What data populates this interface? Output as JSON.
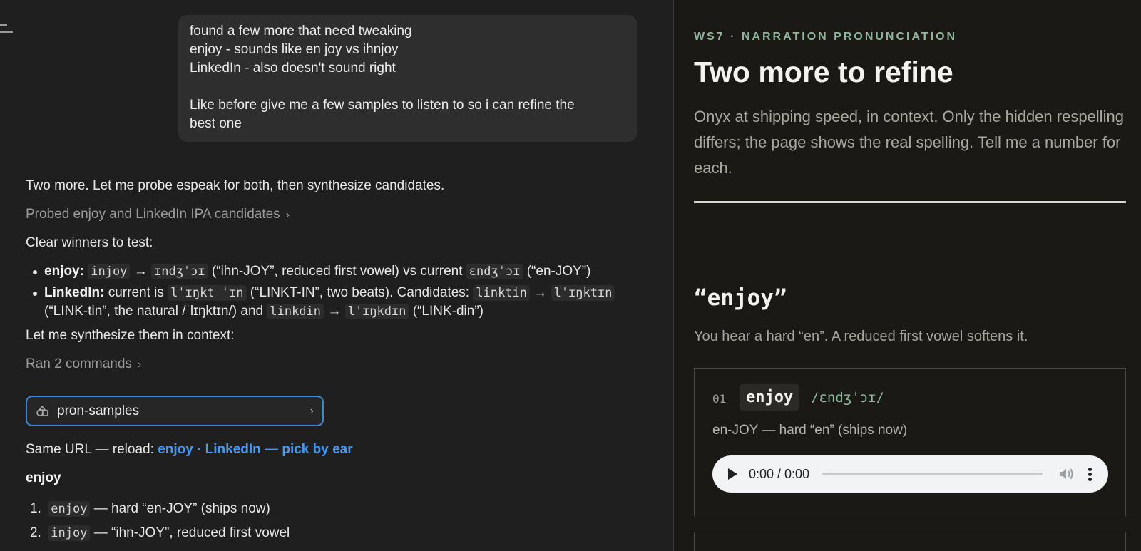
{
  "chat": {
    "user_message": {
      "lines": [
        "found a few more that need tweaking",
        "enjoy - sounds like en joy vs ihnjoy",
        "LinkedIn - also doesn't sound right",
        "",
        "Like before give me a few samples to listen to so i can refine the",
        "best one"
      ]
    },
    "assistant": {
      "intro": "Two more. Let me probe espeak for both, then synthesize candidates.",
      "probe_toggle": "Probed enjoy and LinkedIn IPA candidates",
      "winners_heading": "Clear winners to test:",
      "bullet_enjoy": {
        "label": "enjoy:",
        "code1": "injoy",
        "arrow": "→",
        "code2": "ɪndʒˈɔɪ",
        "text1": "(“ihn-JOY”, reduced first vowel) vs current",
        "code3": "ɛndʒˈɔɪ",
        "text2": "(“en-JOY”)"
      },
      "bullet_linkedin": {
        "label": "LinkedIn:",
        "text1": "current is",
        "code1": "lˈɪŋkt ˈɪn",
        "text2": "(“LINKT-IN”, two beats). Candidates:",
        "code2": "linktin",
        "arrow": "→",
        "code3": "lˈɪŋktɪn",
        "text3": "(“LINK-tin”, the natural /ˈlɪŋktɪn/) and",
        "code4": "linkdin",
        "code5": "lˈɪŋkdɪn",
        "text4": "(“LINK-din”)"
      },
      "synth_line": "Let me synthesize them in context:",
      "commands_toggle": "Ran 2 commands",
      "artifact_name": "pron-samples",
      "reload_prefix": "Same URL — reload:",
      "reload_link": "enjoy · LinkedIn — pick by ear",
      "section_heading": "enjoy",
      "picks": [
        {
          "num": "1.",
          "code": "enjoy",
          "text": "— hard “en-JOY” (ships now)"
        },
        {
          "num": "2.",
          "code": "injoy",
          "text": "— “ihn-JOY”, reduced first vowel"
        }
      ]
    }
  },
  "preview": {
    "eyebrow": "WS7 · NARRATION PRONUNCIATION",
    "title": "Two more to refine",
    "description": "Onyx at shipping speed, in context. Only the hidden respelling differs; the page shows the real spelling. Tell me a number for each.",
    "word_heading": "“enjoy”",
    "word_description": "You hear a hard “en”. A reduced first vowel softens it.",
    "cards": [
      {
        "index": "01",
        "word": "enjoy",
        "ipa": "/ɛndʒˈɔɪ/",
        "description": "en-JOY — hard “en” (ships now)",
        "player_time": "0:00 / 0:00"
      }
    ]
  },
  "colors": {
    "accent_blue": "#3f86d6",
    "link_blue": "#4a98ee",
    "eyebrow_green": "#8fb89a",
    "chat_bg": "#1f1f1f",
    "preview_bg": "#1a1916"
  }
}
